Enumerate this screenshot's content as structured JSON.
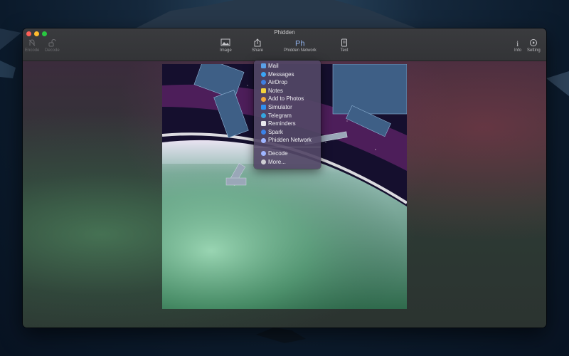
{
  "window": {
    "title": "Phidden"
  },
  "toolbar": {
    "encode_label": "Encode",
    "decode_label": "Decode",
    "image_label": "Image",
    "share_label": "Share",
    "network_label": "Phidden Network",
    "text_label": "Text",
    "info_label": "Info",
    "setting_label": "Setting"
  },
  "share_menu": {
    "items": [
      {
        "label": "Mail",
        "icon": "mail-icon",
        "color": "#5aa0e8"
      },
      {
        "label": "Messages",
        "icon": "messages-icon",
        "color": "#3aa5f5"
      },
      {
        "label": "AirDrop",
        "icon": "airdrop-icon",
        "color": "#3f7fe0"
      },
      {
        "label": "Notes",
        "icon": "notes-icon",
        "color": "#f4d23c"
      },
      {
        "label": "Add to Photos",
        "icon": "photos-icon",
        "color": "#f0a63c"
      },
      {
        "label": "Simulator",
        "icon": "simulator-icon",
        "color": "#2f8ff0"
      },
      {
        "label": "Telegram",
        "icon": "telegram-icon",
        "color": "#34a6e0"
      },
      {
        "label": "Reminders",
        "icon": "reminders-icon",
        "color": "#e8e8ec"
      },
      {
        "label": "Spark",
        "icon": "spark-icon",
        "color": "#3b82e8"
      },
      {
        "label": "Phidden Network",
        "icon": "phidden-network-icon",
        "color": "#9fb6ff"
      }
    ],
    "extra_items": [
      {
        "label": "Decode",
        "icon": "decode-icon",
        "color": "#9fb6ff"
      },
      {
        "label": "More...",
        "icon": "more-icon",
        "color": "#cfcfd4"
      }
    ]
  }
}
